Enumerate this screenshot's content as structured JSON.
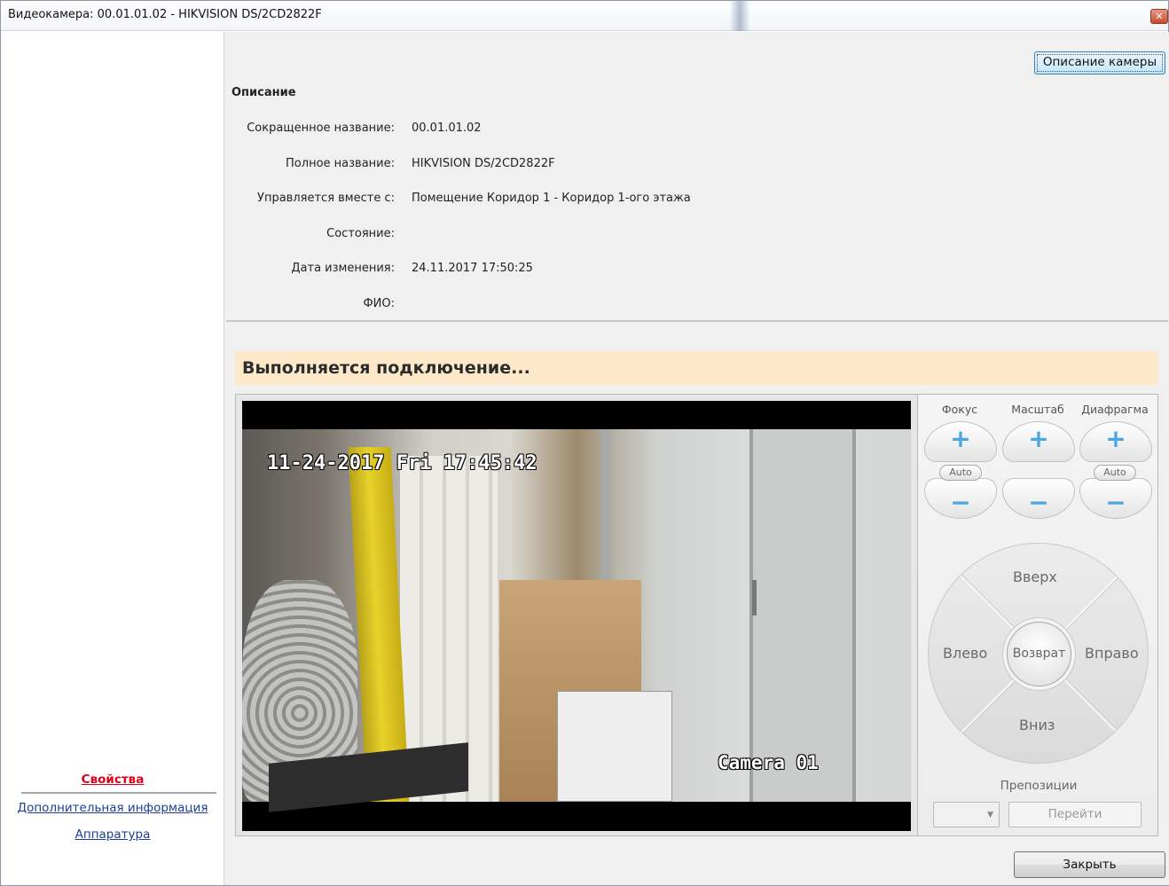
{
  "window": {
    "title": "Видеокамера: 00.01.01.02 - HIKVISION DS/2CD2822F",
    "close_glyph": "✕"
  },
  "sidebar": {
    "items": [
      {
        "label": "Свойства",
        "active": true
      },
      {
        "label": "Дополнительная информация",
        "active": false
      },
      {
        "label": "Аппаратура",
        "active": false
      }
    ]
  },
  "header": {
    "camera_description_button": "Описание камеры"
  },
  "description": {
    "heading": "Описание",
    "fields": [
      {
        "label": "Сокращенное название:",
        "value": "00.01.01.02"
      },
      {
        "label": "Полное название:",
        "value": "HIKVISION DS/2CD2822F"
      },
      {
        "label": "Управляется вместе с:",
        "value": "Помещение Коридор 1 - Коридор 1-ого этажа"
      },
      {
        "label": "Состояние:",
        "value": ""
      },
      {
        "label": "Дата изменения:",
        "value": "24.11.2017 17:50:25"
      },
      {
        "label": "ФИО:",
        "value": ""
      }
    ]
  },
  "video": {
    "status_banner": "Выполняется подключение...",
    "osd_timestamp": "11-24-2017 Fri 17:45:42",
    "osd_camera_name": "Camera 01"
  },
  "controls": {
    "focus_label": "Фокус",
    "zoom_label": "Масштаб",
    "iris_label": "Диафрагма",
    "plus_glyph": "+",
    "minus_glyph": "−",
    "auto_label": "Auto",
    "ptz": {
      "up": "Вверх",
      "down": "Вниз",
      "left": "Влево",
      "right": "Вправо",
      "home": "Возврат"
    },
    "presets_label": "Препозиции",
    "preset_value": "",
    "dropdown_glyph": "▼",
    "goto_button": "Перейти"
  },
  "footer": {
    "close_button": "Закрыть"
  },
  "colors": {
    "active_link": "#e0001a",
    "link": "#1b3f9a",
    "banner_bg": "#fde9c9",
    "lens_glyph": "#4ba7e3"
  }
}
